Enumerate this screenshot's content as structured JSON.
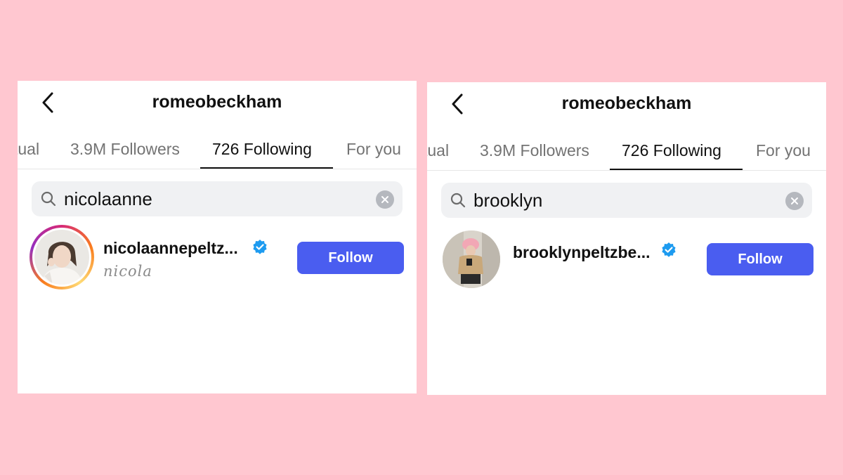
{
  "background_color": "#ffc7d0",
  "accent_color": "#4a5df0",
  "panels": [
    {
      "title": "romeobeckham",
      "tabs": [
        "tual",
        "3.9M Followers",
        "726 Following",
        "For you"
      ],
      "active_tab": "726 Following",
      "search": {
        "value": "nicolaanne",
        "icon": "search-icon"
      },
      "result": {
        "username": "nicolaannepeltz...",
        "subname": "nicola",
        "verified": true,
        "has_story_ring": true,
        "follow_label": "Follow"
      }
    },
    {
      "title": "romeobeckham",
      "tabs": [
        "tual",
        "3.9M Followers",
        "726 Following",
        "For you"
      ],
      "active_tab": "726 Following",
      "search": {
        "value": "brooklyn",
        "icon": "search-icon"
      },
      "result": {
        "username": "brooklynpeltzbe...",
        "verified": true,
        "has_story_ring": false,
        "follow_label": "Follow"
      }
    }
  ]
}
